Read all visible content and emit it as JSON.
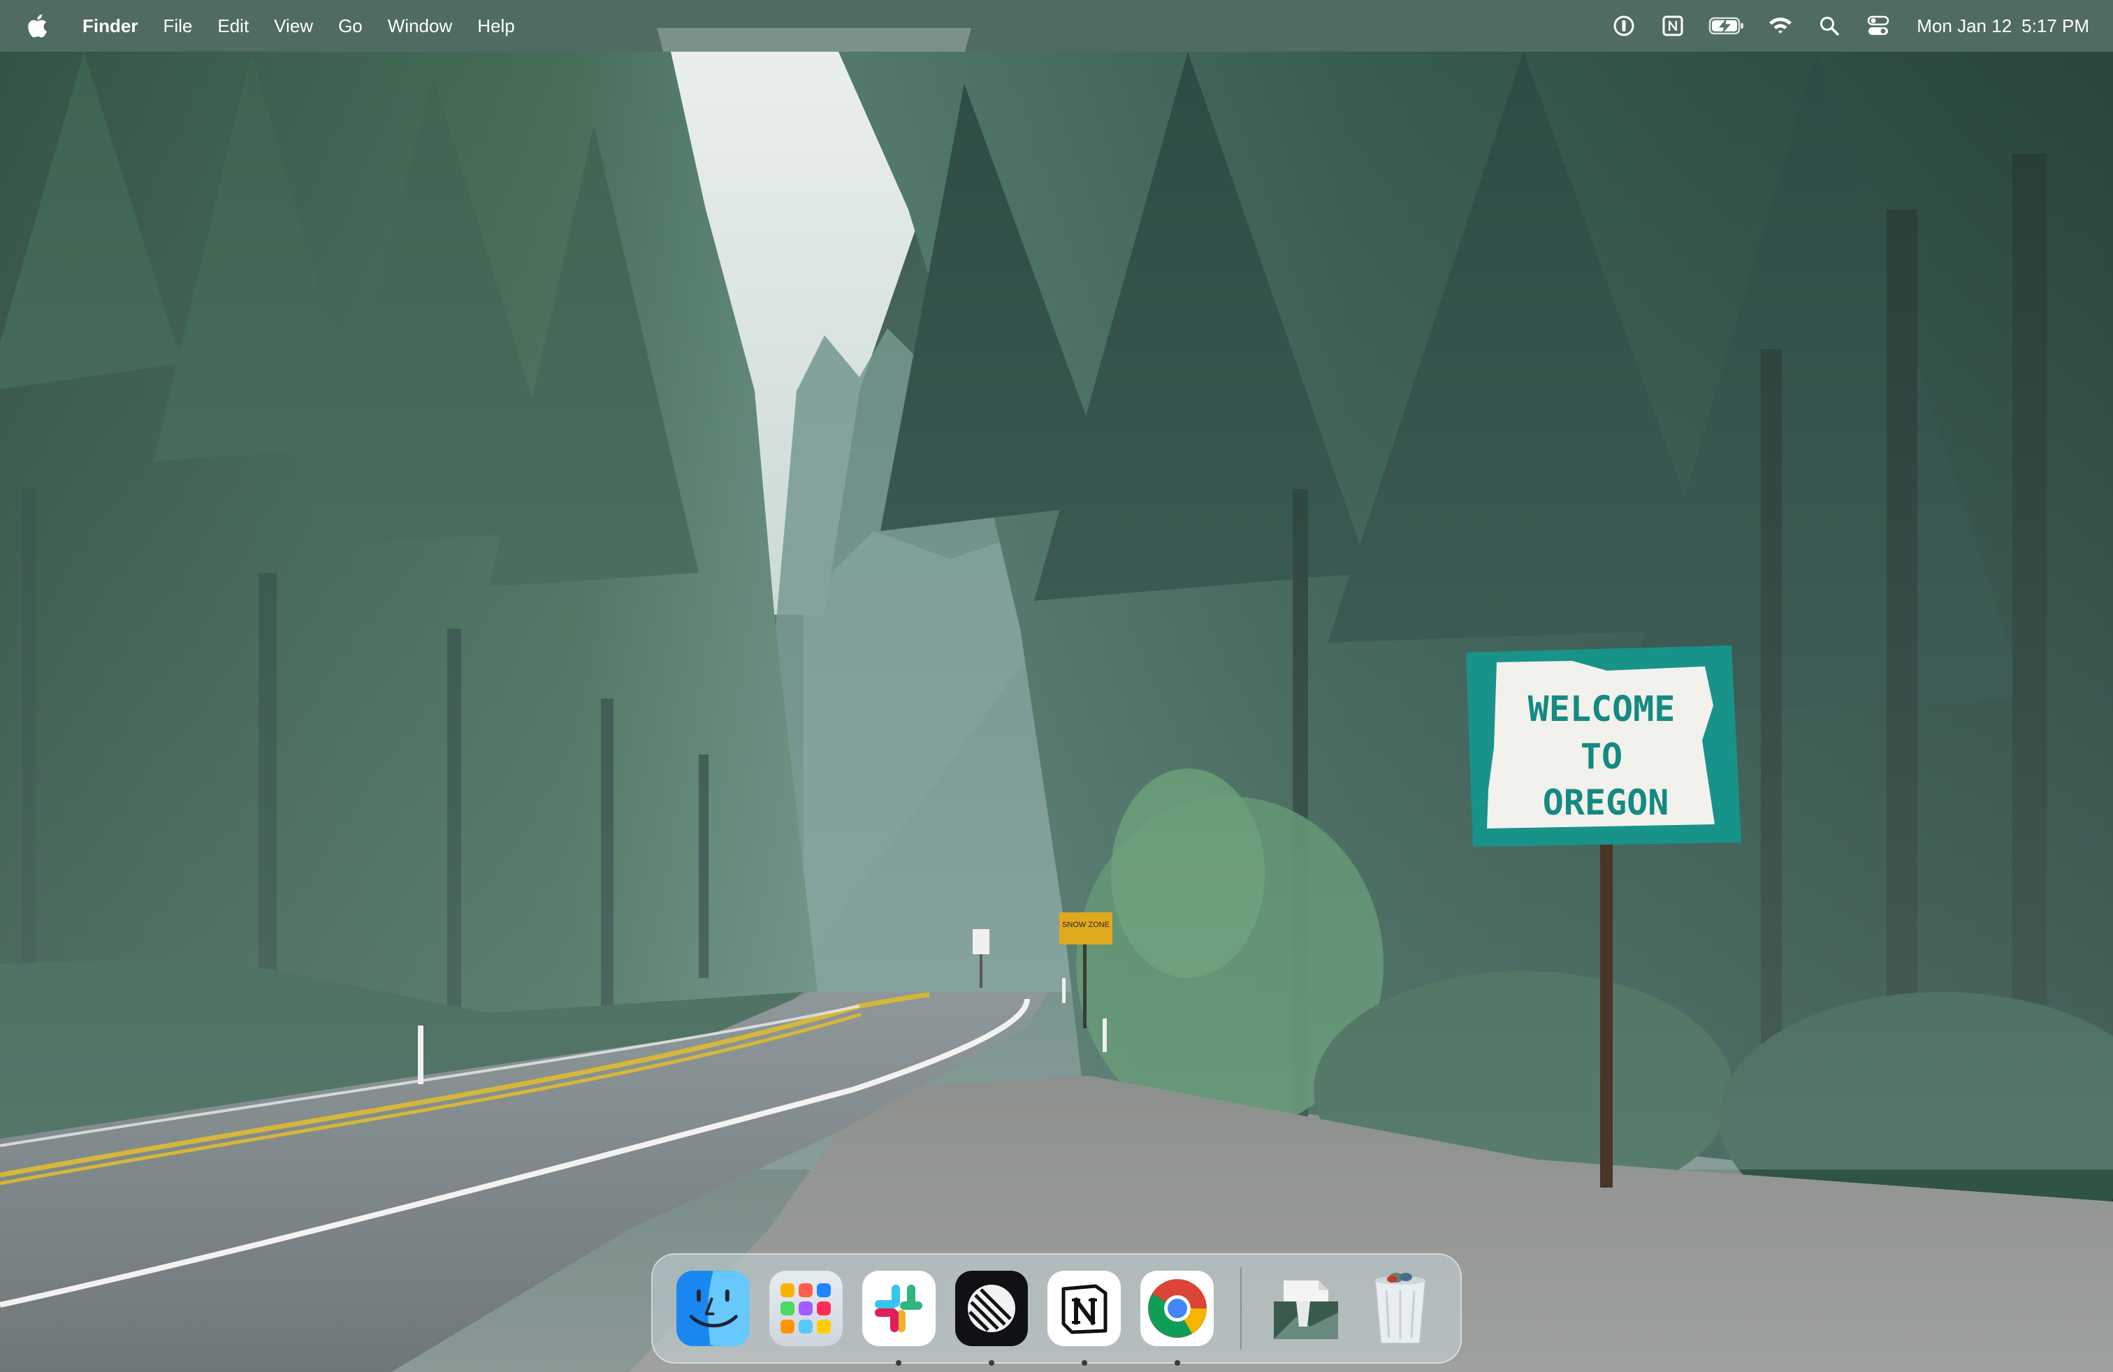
{
  "menubar": {
    "app_name": "Finder",
    "menus": [
      "File",
      "Edit",
      "View",
      "Go",
      "Window",
      "Help"
    ],
    "status_icons": [
      "onepassword-icon",
      "notion-menubar-icon",
      "battery-charging-icon",
      "wifi-icon",
      "spotlight-search-icon",
      "control-center-icon"
    ],
    "clock": {
      "date": "Mon Jan 12",
      "time": "5:17 PM"
    }
  },
  "wallpaper": {
    "sign_lines": [
      "WELCOME",
      "TO",
      "OREGON"
    ],
    "road_sign_text": "SNOW ZONE"
  },
  "dock": {
    "apps": [
      {
        "name": "Finder",
        "icon": "finder-icon",
        "running": true
      },
      {
        "name": "Launchpad",
        "icon": "launchpad-icon",
        "running": false
      },
      {
        "name": "Slack",
        "icon": "slack-icon",
        "running": true
      },
      {
        "name": "Linear",
        "icon": "linear-icon",
        "running": true
      },
      {
        "name": "Notion",
        "icon": "notion-icon",
        "running": true
      },
      {
        "name": "Google Chrome",
        "icon": "chrome-icon",
        "running": true
      }
    ],
    "others": [
      {
        "name": "Wallpaper image",
        "icon": "image-file-icon"
      },
      {
        "name": "Trash",
        "icon": "trash-icon"
      }
    ]
  },
  "colors": {
    "menubar_bg": "#58746c",
    "sign_green": "#17938a",
    "road_line_yellow": "#d6b73a"
  }
}
